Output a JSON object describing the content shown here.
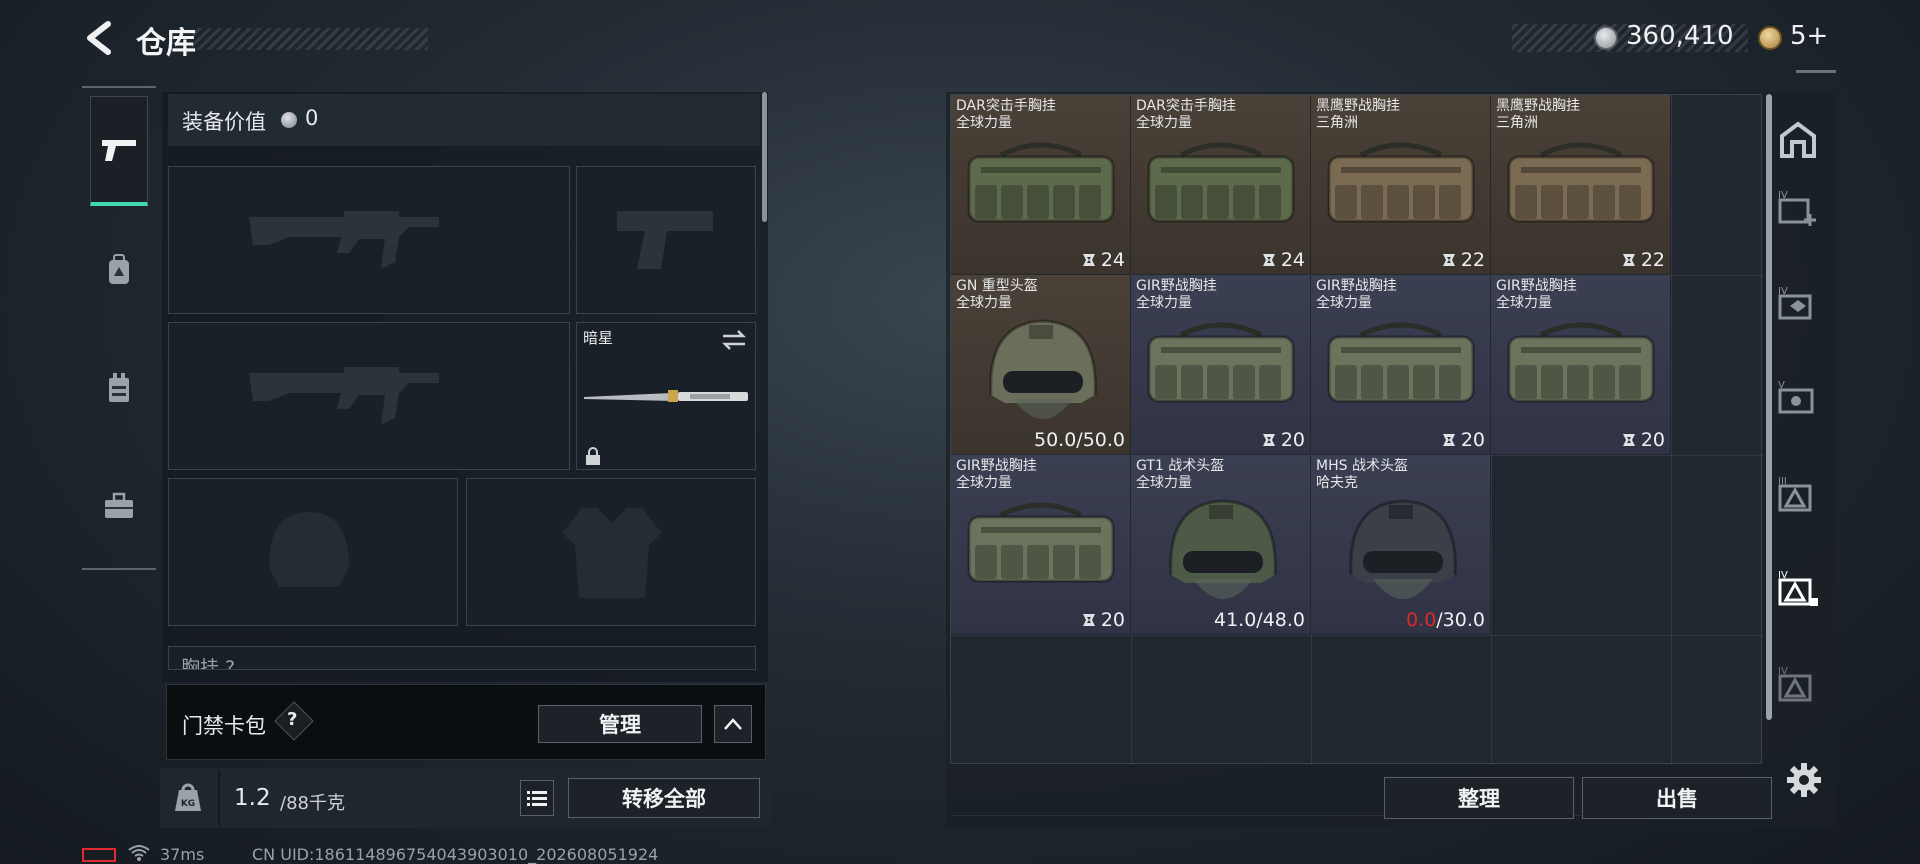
{
  "header": {
    "title": "仓库",
    "currency_amount": "360,410",
    "badge_count": "5+"
  },
  "equipment": {
    "value_label": "装备价值",
    "value_amount": "0",
    "knife_name": "暗星",
    "chest_label_partial": "胸挂 ?",
    "keycard_label": "门禁卡包",
    "keycard_help": "?",
    "manage_label": "管理"
  },
  "weight": {
    "current": "1.2",
    "max_text": "/88千克"
  },
  "buttons": {
    "transfer_all": "转移全部",
    "organize": "整理",
    "sell": "出售"
  },
  "sidebar_icons": [
    "pistol-icon",
    "backpack-icon",
    "chest-rig-icon",
    "toolbox-icon"
  ],
  "right_tabs": [
    "vault-icon",
    "add-crate-icon",
    "crate-transfer-icon",
    "crate-v-icon",
    "crate-iii-icon",
    "crate-iv-active-icon",
    "crate-iv-icon"
  ],
  "items": [
    {
      "name": "DAR突击手胸挂",
      "sub": "全球力量",
      "value": "24",
      "kind": "bag",
      "bg": "brown",
      "tint": "#5e6a4c"
    },
    {
      "name": "DAR突击手胸挂",
      "sub": "全球力量",
      "value": "24",
      "kind": "bag",
      "bg": "brown",
      "tint": "#5e6a4c"
    },
    {
      "name": "黑鹰野战胸挂",
      "sub": "三角洲",
      "value": "22",
      "kind": "bag",
      "bg": "brown",
      "tint": "#7a6b52"
    },
    {
      "name": "黑鹰野战胸挂",
      "sub": "三角洲",
      "value": "22",
      "kind": "bag",
      "bg": "brown",
      "tint": "#7a6b52"
    },
    {
      "name": "GN 重型头盔",
      "sub": "全球力量",
      "value": "50.0/50.0",
      "kind": "helmet",
      "bg": "brown",
      "tint": "#6b6e5a"
    },
    {
      "name": "GIR野战胸挂",
      "sub": "全球力量",
      "value": "20",
      "kind": "bag",
      "bg": "blue",
      "tint": "#6a735c"
    },
    {
      "name": "GIR野战胸挂",
      "sub": "全球力量",
      "value": "20",
      "kind": "bag",
      "bg": "blue",
      "tint": "#6a735c"
    },
    {
      "name": "GIR野战胸挂",
      "sub": "全球力量",
      "value": "20",
      "kind": "bag",
      "bg": "blue",
      "tint": "#6a735c"
    },
    {
      "name": "GIR野战胸挂",
      "sub": "全球力量",
      "value": "20",
      "kind": "bag",
      "bg": "blue",
      "tint": "#6a735c"
    },
    {
      "name": "GT1 战术头盔",
      "sub": "全球力量",
      "value": "41.0/48.0",
      "kind": "helmet",
      "bg": "blue",
      "tint": "#4e5a48"
    },
    {
      "name": "MHS 战术头盔",
      "sub": "哈夫克",
      "value_current": "0.0",
      "value_max": "/30.0",
      "kind": "helmet",
      "bg": "blue",
      "tint": "#3a3f48"
    }
  ],
  "status": {
    "ping": "37ms",
    "uid": "CN UID:186114896754043903010_202608051924"
  },
  "colors": {
    "accent": "#3fd9b0",
    "brown_cell": "#4a4138",
    "blue_cell": "#3b3f52",
    "broken": "#e0282e"
  }
}
